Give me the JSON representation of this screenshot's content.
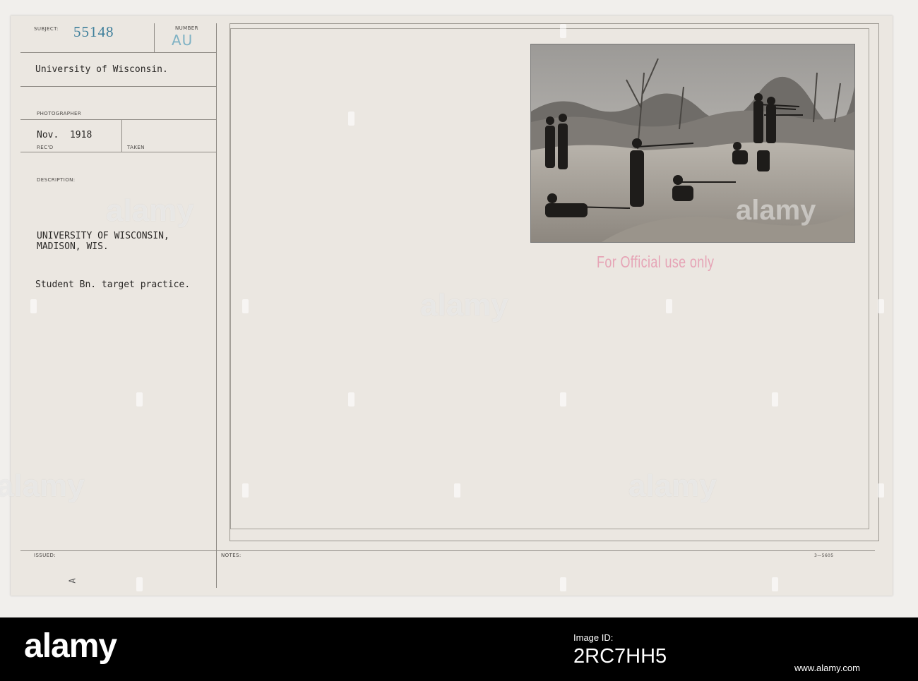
{
  "card": {
    "subject_label": "SUBJECT:",
    "subject_number": "55148",
    "number_label": "NUMBER",
    "number_value": "AU",
    "subject_title": "University of Wisconsin.",
    "photographer_label": "PHOTOGRAPHER",
    "recd_value": "Nov.  1918",
    "recd_label": "REC'D",
    "taken_label": "TAKEN",
    "description_label": "DESCRIPTION:",
    "description_line1": "UNIVERSITY OF WISCONSIN,",
    "description_line2": "MADISON, WIS.",
    "description_line3": "Student Bn. target practice.",
    "issued_label": "ISSUED:",
    "notes_label": "NOTES:",
    "issued_mark": "A",
    "form_number": "3—5605",
    "stamp_text": "For Official use only"
  },
  "watermark": {
    "text": "alamy"
  },
  "footer": {
    "logo": "alamy",
    "image_id_label": "Image ID:",
    "image_id": "2RC7HH5",
    "url": "www.alamy.com"
  }
}
